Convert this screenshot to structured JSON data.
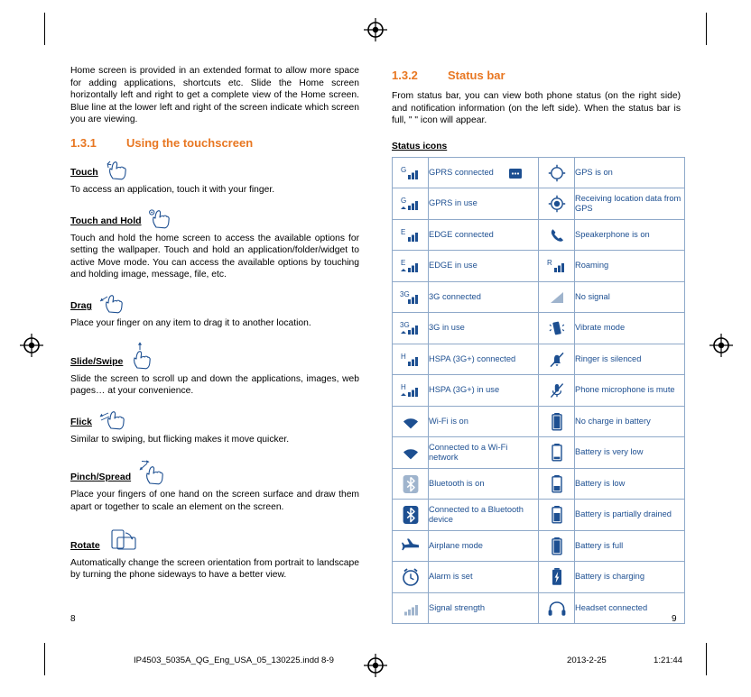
{
  "document": {
    "left_column": {
      "intro_paragraph": "Home screen is provided in an extended format to allow more space for adding applications, shortcuts etc. Slide the Home screen horizontally left and right to get a complete view of the Home screen. Blue line at the lower left and right of the screen indicate which screen you are viewing.",
      "section": {
        "number": "1.3.1",
        "title": "Using the touchscreen"
      },
      "gestures": [
        {
          "name": "Touch",
          "icon": "touch-icon",
          "text": "To access an application, touch it with your finger."
        },
        {
          "name": "Touch and Hold",
          "icon": "touch-and-hold-icon",
          "text": "Touch and hold the home screen to access the available options for setting the wallpaper. Touch and hold an application/folder/widget to active Move mode. You can access the available options by touching and holding image, message, file, etc."
        },
        {
          "name": "Drag",
          "icon": "drag-icon",
          "text": "Place your finger on any item to drag it to another location."
        },
        {
          "name": "Slide/Swipe",
          "icon": "slide-swipe-icon",
          "text": "Slide the screen to scroll up and down the applications, images, web pages… at your convenience."
        },
        {
          "name": "Flick",
          "icon": "flick-icon",
          "text": "Similar to swiping, but flicking makes it move quicker."
        },
        {
          "name": "Pinch/Spread",
          "icon": "pinch-spread-icon",
          "text": "Place your fingers of one hand on the screen surface and draw them apart or together to scale an element on the screen."
        },
        {
          "name": "Rotate",
          "icon": "rotate-icon",
          "text": "Automatically change the screen orientation from portrait to landscape by turning the phone sideways to have a better view."
        }
      ],
      "page_number": "8"
    },
    "right_column": {
      "section": {
        "number": "1.3.2",
        "title": "Status bar"
      },
      "intro_paragraph": "From status bar, you can view both phone status (on the right side) and notification information (on the left side). When the status bar is full, \"      \"  icon will appear.",
      "status_icons_label": "Status icons",
      "status_table": [
        {
          "left_icon": "gprs-connected-icon",
          "left_label": "GPRS connected",
          "right_icon": "gps-on-icon",
          "right_label": "GPS is on"
        },
        {
          "left_icon": "gprs-in-use-icon",
          "left_label": "GPRS in use",
          "right_icon": "receiving-location-data-icon",
          "right_label": "Receiving location data from GPS"
        },
        {
          "left_icon": "edge-connected-icon",
          "left_label": "EDGE connected",
          "right_icon": "speakerphone-on-icon",
          "right_label": "Speakerphone is on"
        },
        {
          "left_icon": "edge-in-use-icon",
          "left_label": "EDGE in use",
          "right_icon": "roaming-icon",
          "right_label": "Roaming"
        },
        {
          "left_icon": "3g-connected-icon",
          "left_label": "3G connected",
          "right_icon": "no-signal-icon",
          "right_label": "No signal"
        },
        {
          "left_icon": "3g-in-use-icon",
          "left_label": "3G in use",
          "right_icon": "vibrate-mode-icon",
          "right_label": "Vibrate mode"
        },
        {
          "left_icon": "hspa-connected-icon",
          "left_label": "HSPA (3G+) connected",
          "right_icon": "ringer-silenced-icon",
          "right_label": "Ringer is silenced"
        },
        {
          "left_icon": "hspa-in-use-icon",
          "left_label": "HSPA (3G+) in use",
          "right_icon": "phone-microphone-mute-icon",
          "right_label": "Phone microphone is mute"
        },
        {
          "left_icon": "wifi-on-icon",
          "left_label": "Wi-Fi is on",
          "right_icon": "no-charge-battery-icon",
          "right_label": "No charge in battery"
        },
        {
          "left_icon": "wifi-connected-icon",
          "left_label": "Connected to a Wi-Fi network",
          "right_icon": "battery-very-low-icon",
          "right_label": "Battery is very low"
        },
        {
          "left_icon": "bluetooth-on-icon",
          "left_label": "Bluetooth is on",
          "right_icon": "battery-low-icon",
          "right_label": "Battery is low"
        },
        {
          "left_icon": "bluetooth-connected-icon",
          "left_label": "Connected to a Bluetooth device",
          "right_icon": "battery-partially-drained-icon",
          "right_label": "Battery is partially drained"
        },
        {
          "left_icon": "airplane-mode-icon",
          "left_label": "Airplane mode",
          "right_icon": "battery-full-icon",
          "right_label": "Battery is full"
        },
        {
          "left_icon": "alarm-set-icon",
          "left_label": "Alarm is set",
          "right_icon": "battery-charging-icon",
          "right_label": "Battery is charging"
        },
        {
          "left_icon": "signal-strength-icon",
          "left_label": "Signal strength",
          "right_icon": "headset-connected-icon",
          "right_label": "Headset connected"
        }
      ],
      "page_number": "9"
    },
    "print_bar": {
      "filename": "IP4503_5035A_QG_Eng_USA_05_130225.indd   8-9",
      "date": "2013-2-25",
      "time": "1:21:44"
    },
    "colors": {
      "accent_orange": "#e87722",
      "table_text_blue": "#1d4f91",
      "table_border": "#8fa9c9",
      "icon_blue": "#1d4f91"
    }
  }
}
